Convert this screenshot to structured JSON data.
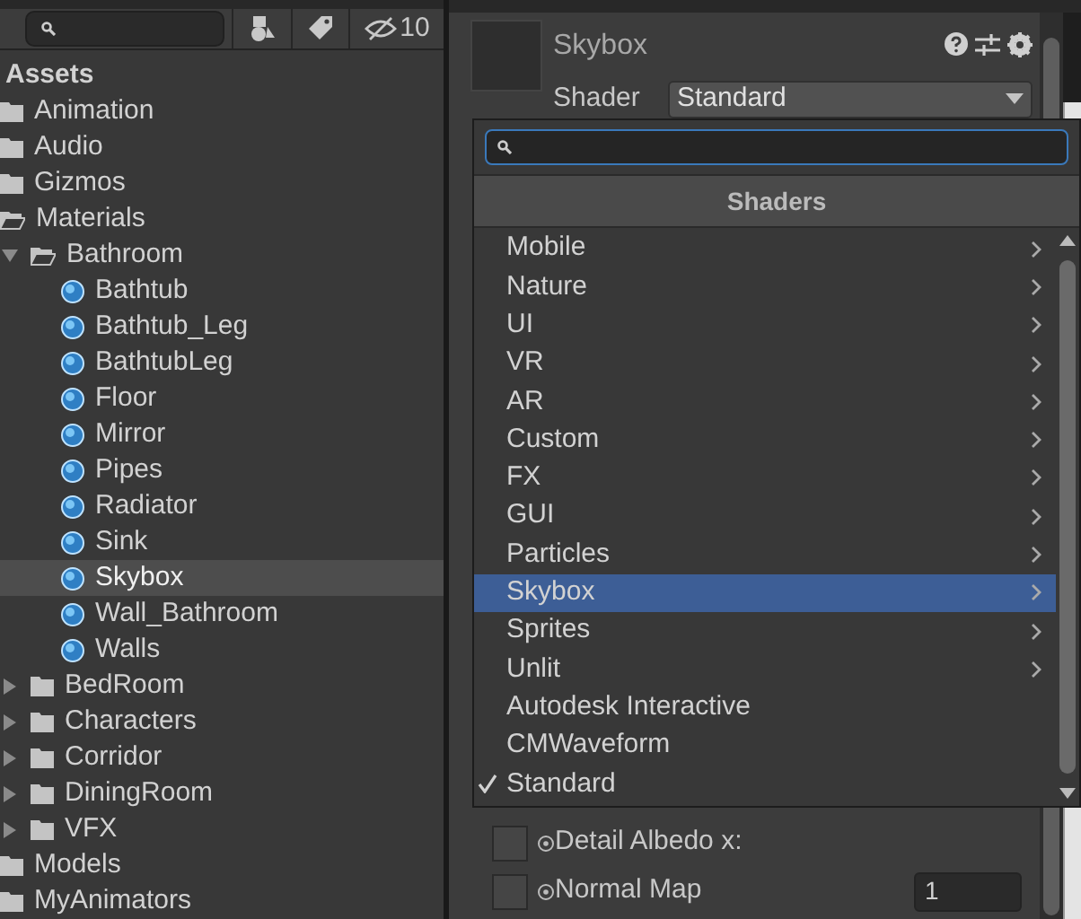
{
  "project": {
    "hidden_count": "10",
    "tree": [
      {
        "label": "Assets",
        "kind": "header"
      },
      {
        "label": "Animation",
        "kind": "folder",
        "selected": false
      },
      {
        "label": "Audio",
        "kind": "folder",
        "selected": false
      },
      {
        "label": "Gizmos",
        "kind": "folder",
        "selected": false
      },
      {
        "label": "Materials",
        "kind": "folder",
        "expanded": true,
        "selected": false,
        "children": [
          {
            "label": "Bathroom",
            "kind": "folder",
            "expanded": true,
            "selected": false,
            "children": [
              {
                "label": "Bathtub",
                "kind": "material",
                "selected": false
              },
              {
                "label": "Bathtub_Leg",
                "kind": "material",
                "selected": false
              },
              {
                "label": "BathtubLeg",
                "kind": "material",
                "selected": false
              },
              {
                "label": "Floor",
                "kind": "material",
                "selected": false
              },
              {
                "label": "Mirror",
                "kind": "material",
                "selected": false
              },
              {
                "label": "Pipes",
                "kind": "material",
                "selected": false
              },
              {
                "label": "Radiator",
                "kind": "material",
                "selected": false
              },
              {
                "label": "Sink",
                "kind": "material",
                "selected": false
              },
              {
                "label": "Skybox",
                "kind": "material",
                "selected": true
              },
              {
                "label": "Wall_Bathroom",
                "kind": "material",
                "selected": false
              },
              {
                "label": "Walls",
                "kind": "material",
                "selected": false
              }
            ]
          },
          {
            "label": "BedRoom",
            "kind": "folder",
            "expanded": false,
            "selected": false
          },
          {
            "label": "Characters",
            "kind": "folder",
            "expanded": false,
            "selected": false
          },
          {
            "label": "Corridor",
            "kind": "folder",
            "expanded": false,
            "selected": false
          },
          {
            "label": "DiningRoom",
            "kind": "folder",
            "expanded": false,
            "selected": false
          },
          {
            "label": "VFX",
            "kind": "folder",
            "expanded": false,
            "selected": false
          }
        ]
      },
      {
        "label": "Models",
        "kind": "folder",
        "selected": false
      },
      {
        "label": "MyAnimators",
        "kind": "folder",
        "selected": false
      }
    ]
  },
  "inspector": {
    "title": "Skybox",
    "shader_label": "Shader",
    "shader_value": "Standard",
    "properties": [
      {
        "label": "Detail Albedo x:"
      },
      {
        "label": "Normal Map",
        "value": "1"
      }
    ]
  },
  "shader_menu": {
    "header": "Shaders",
    "items": [
      {
        "label": "Mobile",
        "kind": "submenu",
        "selected": false,
        "checked": false
      },
      {
        "label": "Nature",
        "kind": "submenu",
        "selected": false,
        "checked": false
      },
      {
        "label": "UI",
        "kind": "submenu",
        "selected": false,
        "checked": false
      },
      {
        "label": "VR",
        "kind": "submenu",
        "selected": false,
        "checked": false
      },
      {
        "label": "AR",
        "kind": "submenu",
        "selected": false,
        "checked": false
      },
      {
        "label": "Custom",
        "kind": "submenu",
        "selected": false,
        "checked": false
      },
      {
        "label": "FX",
        "kind": "submenu",
        "selected": false,
        "checked": false
      },
      {
        "label": "GUI",
        "kind": "submenu",
        "selected": false,
        "checked": false
      },
      {
        "label": "Particles",
        "kind": "submenu",
        "selected": false,
        "checked": false
      },
      {
        "label": "Skybox",
        "kind": "submenu",
        "selected": true,
        "checked": false
      },
      {
        "label": "Sprites",
        "kind": "submenu",
        "selected": false,
        "checked": false
      },
      {
        "label": "Unlit",
        "kind": "submenu",
        "selected": false,
        "checked": false
      },
      {
        "label": "Autodesk Interactive",
        "kind": "shader",
        "selected": false,
        "checked": false
      },
      {
        "label": "CMWaveform",
        "kind": "shader",
        "selected": false,
        "checked": false
      },
      {
        "label": "Standard",
        "kind": "shader",
        "selected": false,
        "checked": true
      }
    ]
  }
}
